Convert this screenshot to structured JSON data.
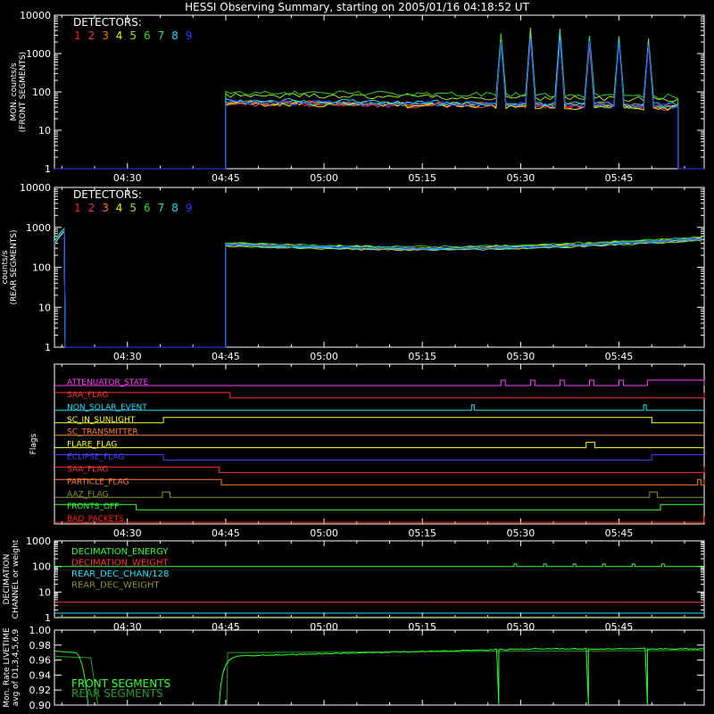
{
  "title": "HESSI Observing Summary, starting on 2005/01/16 04:18:52 UT",
  "time_axis": {
    "start": "04:18:52",
    "end": "05:58:00",
    "tick_labels": [
      "04:30",
      "04:45",
      "05:00",
      "05:15",
      "05:30",
      "05:45"
    ],
    "minor_tick_step_min": 5
  },
  "detectors": {
    "label": "DETECTORS:",
    "items": [
      {
        "num": "1",
        "color": "#ff2020"
      },
      {
        "num": "2",
        "color": "#e8386b"
      },
      {
        "num": "3",
        "color": "#ff7a00"
      },
      {
        "num": "4",
        "color": "#f3f300"
      },
      {
        "num": "5",
        "color": "#9ee01a"
      },
      {
        "num": "6",
        "color": "#2ad12a"
      },
      {
        "num": "7",
        "color": "#22d6a0"
      },
      {
        "num": "8",
        "color": "#22d0ff"
      },
      {
        "num": "9",
        "color": "#2a3aff"
      }
    ]
  },
  "chart_data": [
    {
      "id": "front",
      "type": "line",
      "ylabel": [
        "MON. counts/s",
        "(FRONT SEGMENTS)"
      ],
      "yscale": "log",
      "ylim": [
        1,
        10000
      ],
      "ytick_labels": [
        "1",
        "10",
        "100",
        "1000",
        "10000"
      ],
      "legend": "top-left",
      "segments": [
        {
          "t0": "04:18:52",
          "t1": "04:45:00",
          "level": 1
        },
        {
          "t0": "04:45:00",
          "t1": "05:54:00",
          "level_start": 55,
          "level_end": 43
        },
        {
          "t0": "05:54:00",
          "t1": "05:58:00",
          "level": 1
        }
      ],
      "detector_factors": [
        0.95,
        0.9,
        1.0,
        0.9,
        1.5,
        1.8,
        1.0,
        1.1,
        1.0
      ],
      "spikes": [
        {
          "start": "05:26:30",
          "end": "05:27:30",
          "peak": 3000
        },
        {
          "start": "05:31:00",
          "end": "05:32:00",
          "peak": 4000
        },
        {
          "start": "05:35:40",
          "end": "05:36:40",
          "peak": 3800
        },
        {
          "start": "05:40:10",
          "end": "05:41:10",
          "peak": 2600
        },
        {
          "start": "05:44:40",
          "end": "05:45:40",
          "peak": 3000
        },
        {
          "start": "05:49:10",
          "end": "05:50:10",
          "peak": 2700
        }
      ]
    },
    {
      "id": "rear",
      "type": "line",
      "ylabel": [
        "counts/s",
        "(REAR SEGMENTS)"
      ],
      "yscale": "log",
      "ylim": [
        1,
        10000
      ],
      "ytick_labels": [
        "1",
        "10",
        "100",
        "1000",
        "10000"
      ],
      "legend": "top-left",
      "segments": [
        {
          "t0": "04:18:52",
          "t1": "04:20:30",
          "level_start": 400,
          "level_end": 900
        },
        {
          "t0": "04:20:30",
          "t1": "04:45:00",
          "level": 1
        },
        {
          "t0": "04:45:00",
          "t1": "05:58:00",
          "level_start": 380,
          "level_end": 420,
          "dip": 260
        }
      ],
      "detector_factors": [
        1.0,
        0.95,
        1.0,
        1.05,
        0.9,
        1.1,
        1.0,
        0.95,
        1.0
      ]
    },
    {
      "id": "flags",
      "type": "line",
      "ylabel": [
        "Flags"
      ],
      "rows": [
        {
          "name": "ATTENUATOR_STATE",
          "color": "#ff40ff",
          "base_high": false,
          "events": [
            [
              "05:27:00",
              "05:27:40"
            ],
            [
              "05:31:30",
              "05:32:10"
            ],
            [
              "05:36:00",
              "05:36:40"
            ],
            [
              "05:40:30",
              "05:41:10"
            ],
            [
              "05:45:00",
              "05:45:40"
            ],
            [
              "05:49:20",
              "05:58:00"
            ]
          ]
        },
        {
          "name": "SAA_FLAG",
          "color": "#ff3030",
          "base_high": true,
          "events": [
            [
              "04:45:40",
              "05:58:00"
            ]
          ]
        },
        {
          "name": "NON_SOLAR_EVENT",
          "color": "#20e0ff",
          "base_high": false,
          "events": [
            [
              "05:22:30",
              "05:22:55"
            ],
            [
              "05:48:45",
              "05:49:10"
            ]
          ]
        },
        {
          "name": "SC_IN_SUNLIGHT",
          "color": "#ffff30",
          "base_high": false,
          "events": [
            [
              "04:35:30",
              "05:50:00"
            ]
          ]
        },
        {
          "name": "SC_TRANSMITTER",
          "color": "#ff8030",
          "base_high": false,
          "events": []
        },
        {
          "name": "FLARE_FLAG",
          "color": "#ffff30",
          "base_high": false,
          "events": [
            [
              "05:40:00",
              "05:41:20"
            ]
          ]
        },
        {
          "name": "ECLIPSE_FLAG",
          "color": "#4040ff",
          "base_high": true,
          "events": [
            [
              "04:35:30",
              "05:50:00"
            ]
          ]
        },
        {
          "name": "SAA_FLAG",
          "color": "#ff3030",
          "base_high": true,
          "events": [
            [
              "04:44:00",
              "05:58:00"
            ]
          ]
        },
        {
          "name": "PARTICLE_FLAG",
          "color": "#ff8030",
          "base_high": true,
          "events": [
            [
              "04:44:20",
              "05:57:00"
            ],
            [
              "05:57:30",
              "05:58:00"
            ]
          ]
        },
        {
          "name": "AAZ_FLAG",
          "color": "#909030",
          "base_high": false,
          "events": [
            [
              "04:35:20",
              "04:36:30"
            ],
            [
              "05:49:40",
              "05:50:50"
            ]
          ]
        },
        {
          "name": "FRONTS_OFF",
          "color": "#30ff30",
          "base_high": true,
          "events": [
            [
              "04:31:20",
              "05:51:20"
            ]
          ]
        },
        {
          "name": "BAD_PACKETS",
          "color": "#ff2020",
          "base_high": false,
          "events": [
            [
              "05:57:55",
              "05:58:00"
            ]
          ]
        }
      ]
    },
    {
      "id": "decimation",
      "type": "line",
      "ylabel": [
        "DECIMATION",
        "CHANNEL or weight"
      ],
      "yscale": "log",
      "ylim": [
        1,
        1000
      ],
      "ytick_labels": [
        "1",
        "10",
        "100",
        "1000"
      ],
      "legend": "top-left",
      "series": [
        {
          "name": "DECIMATION_ENERGY",
          "color": "#30ff30",
          "level": 100,
          "bumps": [
            "05:29:00",
            "05:33:30",
            "05:38:00",
            "05:42:30",
            "05:47:00",
            "05:51:30"
          ]
        },
        {
          "name": "DECIMATION_WEIGHT",
          "color": "#ff3030",
          "level": 4
        },
        {
          "name": "REAR_DEC_CHAN/128",
          "color": "#20e0ff",
          "level": 1.5
        },
        {
          "name": "REAR_DEC_WEIGHT",
          "color": "#909030",
          "level": 1.05
        }
      ]
    },
    {
      "id": "livetime",
      "type": "line",
      "ylabel": [
        "Mon. Rate LIVETIME",
        "avg of D1,3,4,5,6,9"
      ],
      "ylim": [
        0.9,
        1.0
      ],
      "ytick_labels": [
        "0.90",
        "0.92",
        "0.94",
        "0.96",
        "0.98",
        "1.00"
      ],
      "legend": "bottom-left",
      "series": [
        {
          "name": "FRONT SEGMENTS",
          "color": "#30ff30"
        },
        {
          "name": "REAR SEGMENTS",
          "color": "#1e9e1e"
        }
      ],
      "front": {
        "pre_level": 0.972,
        "pre_end": "04:24:00",
        "gap_end": "04:44:00",
        "post_level": 0.975,
        "dip_start": "04:45:00",
        "dip_end": "04:48:00",
        "spike_times": [
          "05:26:40",
          "05:31:10",
          "05:35:50",
          "05:40:20",
          "05:44:50",
          "05:49:20"
        ]
      },
      "rear": {
        "pre_level": 0.965,
        "pre_end": "04:25:30",
        "gap_end": "04:45:10",
        "post_level": 0.97
      }
    }
  ]
}
